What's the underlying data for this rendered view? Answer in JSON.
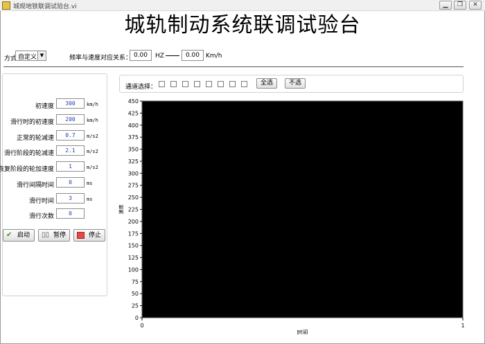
{
  "window": {
    "title": "城规地铁联调试验台.vi",
    "minimize": "▁",
    "maximize": "❐",
    "close": "✕"
  },
  "header": {
    "title": "城轨制动系统联调试验台"
  },
  "mode": {
    "label": "方式",
    "value": "自定义",
    "arrow": "▼"
  },
  "freq": {
    "label": "频率与速度对应关系：",
    "hz_value": "0.00",
    "hz_unit": "HZ",
    "speed_value": "0.00",
    "speed_unit": "Km/h"
  },
  "params": [
    {
      "label": "初速度",
      "value": "300",
      "unit": "km/h"
    },
    {
      "label": "滑行时的初速度",
      "value": "200",
      "unit": "km/h"
    },
    {
      "label": "正常的轮减速",
      "value": "0.7",
      "unit": "m/s2"
    },
    {
      "label": "滑行阶段的轮减速",
      "value": "2.1",
      "unit": "m/s2"
    },
    {
      "label": "恢复阶段的轮加速度",
      "value": "1",
      "unit": "m/s2"
    },
    {
      "label": "滑行间隔时间",
      "value": "0",
      "unit": "ms"
    },
    {
      "label": "滑行时间",
      "value": "3",
      "unit": "ms"
    },
    {
      "label": "滑行次数",
      "value": "0",
      "unit": ""
    }
  ],
  "controls": {
    "start": "启动",
    "pause": "暂停",
    "stop": "停止"
  },
  "channels": {
    "label": "通道选择：",
    "count": 8,
    "select_all": "全选",
    "select_none": "不选"
  },
  "chart_data": {
    "type": "line",
    "title": "",
    "xlabel": "时间",
    "ylabel": "速度",
    "xlim": [
      0,
      1
    ],
    "ylim": [
      0,
      450
    ],
    "x_ticks": [
      "0",
      "1"
    ],
    "y_ticks": [
      "0",
      "25",
      "50",
      "75",
      "100",
      "125",
      "150",
      "175",
      "200",
      "225",
      "250",
      "275",
      "300",
      "325",
      "350",
      "375",
      "400",
      "425",
      "450"
    ],
    "plot_background": "#000000",
    "grid": false,
    "series": []
  }
}
